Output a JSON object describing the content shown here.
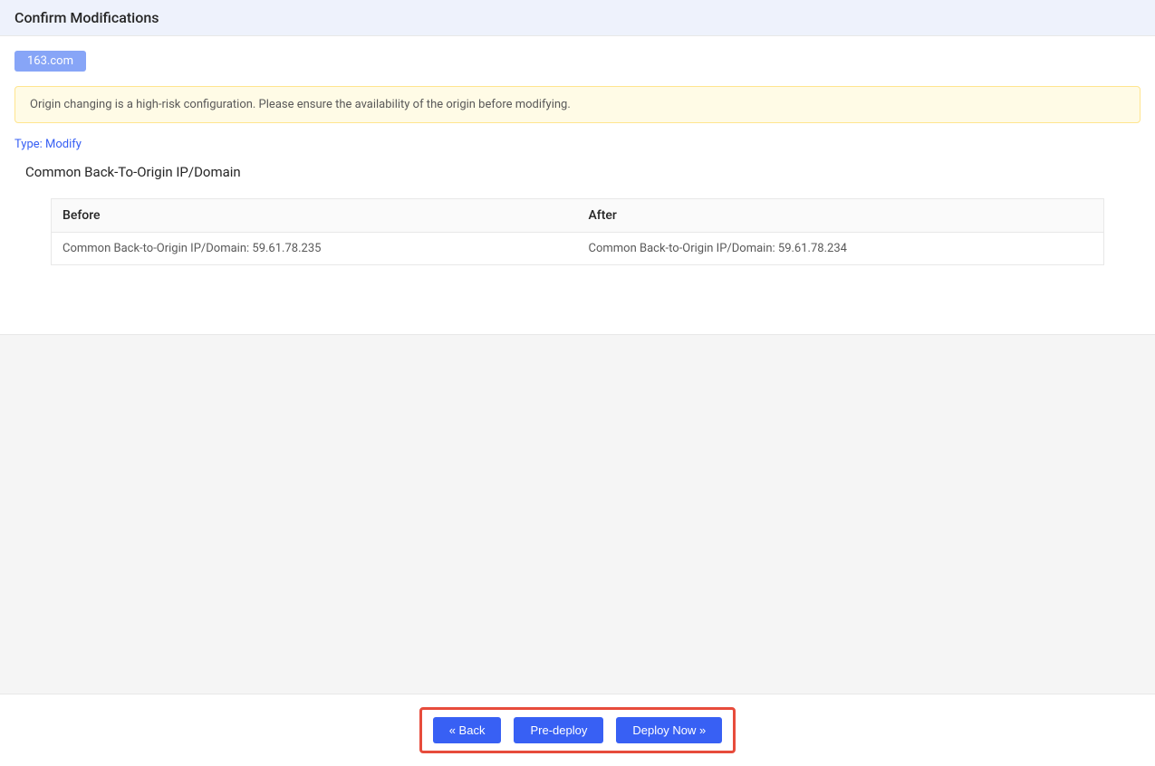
{
  "header": {
    "title": "Confirm Modifications"
  },
  "tab": {
    "label": "163.com"
  },
  "warning": {
    "text": "Origin changing is a high-risk configuration. Please ensure the availability of the origin before modifying."
  },
  "type": {
    "label": "Type: Modify"
  },
  "section": {
    "title": "Common Back-To-Origin IP/Domain"
  },
  "table": {
    "headers": {
      "before": "Before",
      "after": "After"
    },
    "row": {
      "before": "Common Back-to-Origin IP/Domain: 59.61.78.235",
      "after": "Common Back-to-Origin IP/Domain: 59.61.78.234"
    }
  },
  "footer": {
    "back": "« Back",
    "predeploy": "Pre-deploy",
    "deploynow": "Deploy Now »"
  }
}
